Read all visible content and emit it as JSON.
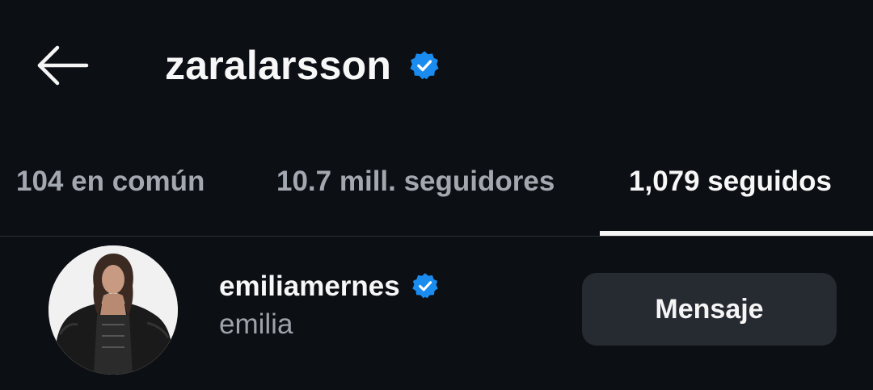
{
  "header": {
    "back_icon": "arrow-left-icon",
    "title": "zaralarsson",
    "verified_icon": "verified-badge-icon",
    "verified_color": "#1a8cf0"
  },
  "tabs": [
    {
      "label": "104 en común",
      "active": false
    },
    {
      "label": "10.7 mill. seguidores",
      "active": false
    },
    {
      "label": "1,079 seguidos",
      "active": true
    }
  ],
  "users": [
    {
      "username": "emiliamernes",
      "full_name": "emilia",
      "verified": true,
      "action_label": "Mensaje"
    }
  ],
  "colors": {
    "background": "#0c0f14",
    "text_primary": "#f7f7f7",
    "text_secondary": "#9ea3ab",
    "button_bg": "#262a31",
    "verified": "#1a8cf0"
  }
}
